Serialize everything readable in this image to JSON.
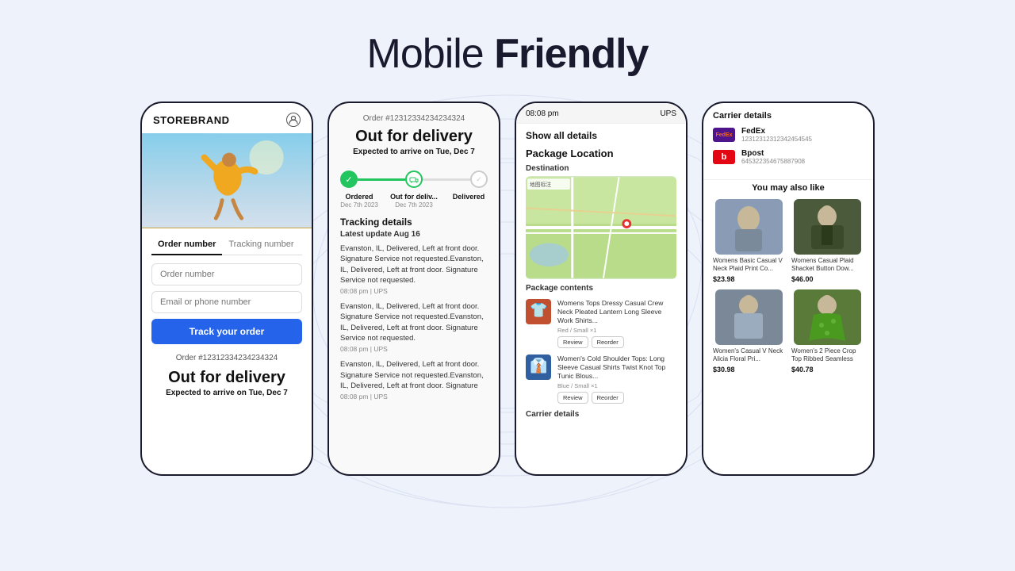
{
  "page": {
    "title_normal": "Mobile ",
    "title_bold": "Friendly"
  },
  "phone1": {
    "brand": "STOREBRAND",
    "tabs": [
      "Order number",
      "Tracking number"
    ],
    "active_tab": "Order number",
    "placeholder_order": "Order number",
    "placeholder_email": "Email or phone number",
    "btn_track": "Track your order",
    "order_number": "Order #12312334234234324",
    "delivery_status": "Out for delivery",
    "eta_label": "Expected to arrive on",
    "eta_date": "Tue, Dec 7"
  },
  "phone2": {
    "order_number": "Order #12312334234234324",
    "title": "Out for delivery",
    "eta_label": "Expected to arrive on",
    "eta_date": "Tue, Dec 7",
    "steps": [
      {
        "label": "Ordered",
        "date": "Dec 7th 2023",
        "state": "done"
      },
      {
        "label": "Out for deliv...",
        "date": "Dec 7th 2023",
        "state": "active"
      },
      {
        "label": "Delivered",
        "date": "",
        "state": "pending"
      }
    ],
    "tracking_title": "Tracking details",
    "latest_update": "Latest update Aug 16",
    "events": [
      {
        "text": "Evanston, IL, Delivered, Left at front door. Signature Service not requested.Evanston, IL, Delivered, Left at front door. Signature Service not requested.",
        "meta": "08:08 pm  |  UPS"
      },
      {
        "text": "Evanston, IL, Delivered, Left at front door. Signature Service not requested.Evanston, IL, Delivered, Left at front door. Signature Service not requested.",
        "meta": "08:08 pm  |  UPS"
      },
      {
        "text": "Evanston, IL, Delivered, Left at front door. Signature Service not requested.Evanston, IL, Delivered, Left at front door. Signature",
        "meta": "08:08 pm  |  UPS"
      }
    ]
  },
  "phone3": {
    "topbar_time": "08:08 pm",
    "topbar_carrier": "UPS",
    "show_all": "Show all details",
    "package_location": "Package Location",
    "destination": "Destination",
    "map_label": "地图标注",
    "package_contents": "Package contents",
    "items": [
      {
        "name": "Womens Tops Dressy Casual Crew Neck Pleated Lantern Long Sleeve Work Shirts...",
        "variant": "Red / Small  ×1",
        "btn1": "Review",
        "btn2": "Reorder"
      },
      {
        "name": "Women's Cold Shoulder Tops: Long Sleeve Casual Shirts Twist Knot Top Tunic Blous...",
        "variant": "Blue / Small  ×1",
        "btn1": "Review",
        "btn2": "Reorder"
      }
    ],
    "carrier_details": "Carrier details"
  },
  "phone4": {
    "carrier_details_title": "Carrier details",
    "carriers": [
      {
        "name": "FedEx",
        "tracking": "12312312312342454545",
        "logo_text": "FedEx",
        "type": "fedex"
      },
      {
        "name": "Bpost",
        "tracking": "645322354675887908",
        "logo_text": "b",
        "type": "bpost"
      }
    ],
    "you_may_like": "You may also like",
    "products": [
      {
        "name": "Womens Basic Casual V Neck Plaid Print Co...",
        "price": "$23.98",
        "bg": "#8a9bb5"
      },
      {
        "name": "Womens Casual Plaid Shacket Button Dow...",
        "price": "$46.00",
        "bg": "#4a5a3a"
      },
      {
        "name": "Women's Casual V Neck Alicia Floral Pri...",
        "price": "$30.98",
        "bg": "#6a7a8a"
      },
      {
        "name": "Women's 2 Piece Crop Top Ribbed Seamless",
        "price": "$40.78",
        "bg": "#5a7a3a"
      }
    ]
  }
}
